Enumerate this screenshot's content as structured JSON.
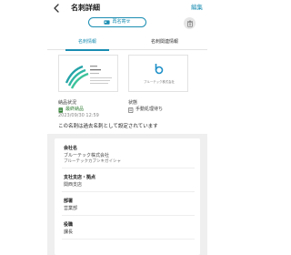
{
  "header": {
    "title": "名刺詳細",
    "edit_label": "編集"
  },
  "actions": {
    "reissue_label": "再名寄せ"
  },
  "tabs": [
    {
      "label": "名刺情報",
      "active": true
    },
    {
      "label": "名刺関連情報",
      "active": false
    }
  ],
  "card_thumbnails": {
    "front_caption": "ブルーテック株式会社",
    "back_caption": "ブルーテック株式会社"
  },
  "delivery_status": {
    "label": "納品状況",
    "value": "最終納品",
    "timestamp": "2023/09/30 12:59"
  },
  "state": {
    "label": "状態",
    "value": "手動処理待ち"
  },
  "notice": "この名刺は過去名刺として設定されています",
  "info": {
    "company_label": "会社名",
    "company_value": "ブルーテック株式会社",
    "company_kana": "ブルーテックカブシキガイシャ",
    "branch_label": "支社支店・拠点",
    "branch_value": "関西支店",
    "department_label": "部署",
    "department_value": "営業部",
    "position_label": "役職",
    "position_value": "課長"
  },
  "colors": {
    "accent": "#1a8db2",
    "success": "#2e7d32",
    "background_gray": "#efefef"
  }
}
